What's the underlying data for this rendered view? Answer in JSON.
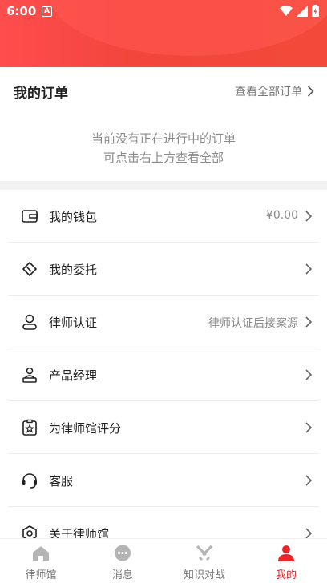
{
  "status_bar": {
    "time": "6:00",
    "notif_letter": "A"
  },
  "orders": {
    "title": "我的订单",
    "view_all": "查看全部订单",
    "empty_line1": "当前没有正在进行中的订单",
    "empty_line2": "可点击右上方查看全部"
  },
  "menu": {
    "items": [
      {
        "label": "我的钱包",
        "value": "¥0.00",
        "icon": "wallet-icon"
      },
      {
        "label": "我的委托",
        "value": "",
        "icon": "entrust-tag-icon"
      },
      {
        "label": "律师认证",
        "value": "律师认证后接案源",
        "icon": "lawyer-person-icon"
      },
      {
        "label": "产品经理",
        "value": "",
        "icon": "product-manager-icon"
      },
      {
        "label": "为律师馆评分",
        "value": "",
        "icon": "rate-clipboard-icon"
      },
      {
        "label": "客服",
        "value": "",
        "icon": "headset-icon"
      },
      {
        "label": "关于律师馆",
        "value": "",
        "icon": "about-icon"
      }
    ]
  },
  "tabs": [
    {
      "label": "律师馆",
      "icon": "home-icon",
      "active": false
    },
    {
      "label": "消息",
      "icon": "chat-icon",
      "active": false
    },
    {
      "label": "知识对战",
      "icon": "swords-icon",
      "active": false
    },
    {
      "label": "我的",
      "icon": "user-icon",
      "active": true
    }
  ],
  "colors": {
    "accent": "#e8272c",
    "header": "#f2453c"
  }
}
